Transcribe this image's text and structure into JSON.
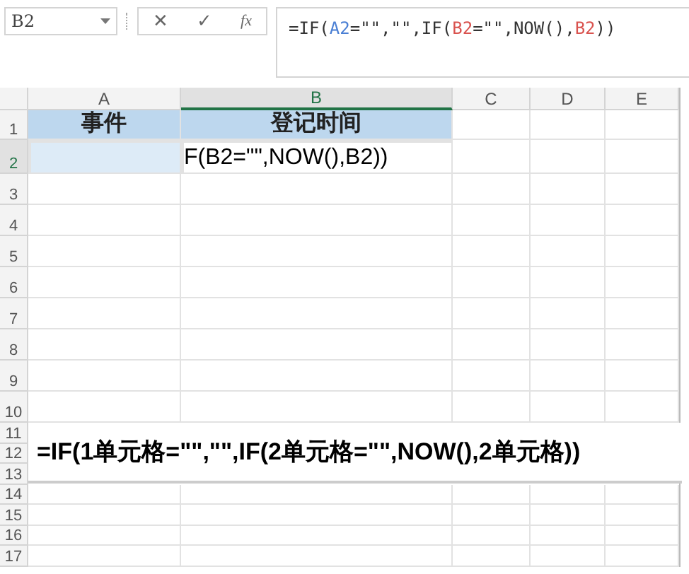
{
  "name_box": "B2",
  "formula_bar": {
    "buttons": [
      "✕",
      "✓",
      "fx"
    ],
    "formula": [
      {
        "text": "=IF(",
        "color": "#333333"
      },
      {
        "text": "A2",
        "color": "#4a7fd4"
      },
      {
        "text": "=\"\",\"\",IF(",
        "color": "#333333"
      },
      {
        "text": "B2",
        "color": "#d9534f"
      },
      {
        "text": "=\"\",NOW(),",
        "color": "#333333"
      },
      {
        "text": "B2",
        "color": "#d9534f"
      },
      {
        "text": "))",
        "color": "#333333"
      }
    ]
  },
  "columns": [
    {
      "label": "A",
      "selected": false
    },
    {
      "label": "B",
      "selected": true
    },
    {
      "label": "C",
      "selected": false
    },
    {
      "label": "D",
      "selected": false
    },
    {
      "label": "E",
      "selected": false
    }
  ],
  "rows": [
    {
      "label": "1",
      "selected": false,
      "cells": [
        "事件",
        "登记时间"
      ]
    },
    {
      "label": "2",
      "selected": true,
      "cells": [
        "",
        "F(B2=\"\",NOW(),B2))"
      ]
    },
    {
      "label": "3",
      "selected": false
    },
    {
      "label": "4",
      "selected": false
    },
    {
      "label": "5",
      "selected": false
    },
    {
      "label": "6",
      "selected": false
    },
    {
      "label": "7",
      "selected": false
    },
    {
      "label": "8",
      "selected": false
    },
    {
      "label": "9",
      "selected": false
    },
    {
      "label": "10",
      "selected": false
    },
    {
      "label": "11",
      "selected": false
    },
    {
      "label": "12",
      "selected": false
    },
    {
      "label": "13",
      "selected": false
    },
    {
      "label": "14",
      "selected": false
    },
    {
      "label": "15",
      "selected": false
    },
    {
      "label": "16",
      "selected": false
    },
    {
      "label": "17",
      "selected": false
    }
  ],
  "annotation": "=IF(1单元格=\"\",\"\",IF(2单元格=\"\",NOW(),2单元格))"
}
